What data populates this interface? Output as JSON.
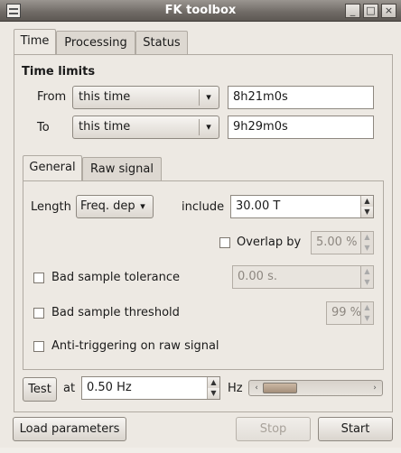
{
  "window": {
    "title": "FK toolbox",
    "minimize_glyph": "_",
    "maximize_glyph": "□",
    "close_glyph": "×"
  },
  "main_tabs": [
    {
      "label": "Time",
      "active": true
    },
    {
      "label": "Processing",
      "active": false
    },
    {
      "label": "Status",
      "active": false
    }
  ],
  "time_limits": {
    "heading": "Time limits",
    "from": {
      "label": "From",
      "mode": "this time",
      "value": "8h21m0s"
    },
    "to": {
      "label": "To",
      "mode": "this time",
      "value": "9h29m0s"
    }
  },
  "sub_tabs": [
    {
      "label": "General",
      "active": true
    },
    {
      "label": "Raw signal",
      "active": false
    }
  ],
  "general": {
    "length_label": "Length",
    "length_mode": "Freq. dep",
    "include_label": "include",
    "include_value": "30.00 T",
    "overlap": {
      "label": "Overlap by",
      "checked": false,
      "value": "5.00 %"
    },
    "bad_sample_tolerance": {
      "label": "Bad sample tolerance",
      "checked": false,
      "value": "0.00 s."
    },
    "bad_sample_threshold": {
      "label": "Bad sample threshold",
      "checked": false,
      "value": "99 %"
    },
    "anti_triggering": {
      "label": "Anti-triggering on raw signal",
      "checked": false
    }
  },
  "test_row": {
    "button_label": "Test",
    "at_label": "at",
    "frequency_value": "0.50 Hz",
    "unit_label": "Hz"
  },
  "footer": {
    "load_label": "Load parameters",
    "stop_label": "Stop",
    "start_label": "Start"
  },
  "icons": {
    "dropdown": "▾",
    "spin_up": "▲",
    "spin_down": "▼",
    "scroll_left": "‹",
    "scroll_right": "›"
  }
}
